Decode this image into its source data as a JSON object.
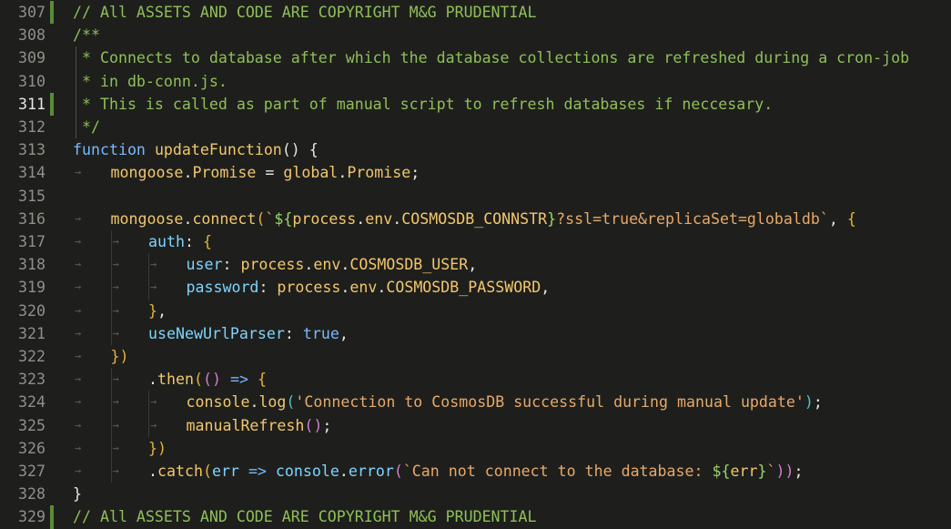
{
  "colors": {
    "background": "#1e1f1c",
    "comment": "#8fbf58",
    "keyword": "#79b8ff",
    "function": "#f2c66d",
    "plain": "#e7e7e2",
    "string": "#e6a86b",
    "property": "#7fd3ff",
    "constant": "#ae8cfc",
    "bracket_gold": "#e2b23c",
    "bracket_pink": "#d67ad7",
    "bracket_teal": "#4fc1c7",
    "interp": "#9ad66a",
    "gutter_modified": "#5a8b39",
    "line_number": "#8f908a",
    "line_number_active": "#e8e8e2",
    "whitespace": "#5a5b55"
  },
  "active_line": "311",
  "lines": [
    {
      "num": "307",
      "mod": true,
      "indent": 0,
      "tokens": [
        {
          "t": "// All ASSETS AND CODE ARE COPYRIGHT M&G PRUDENTIAL",
          "c": "comment"
        }
      ]
    },
    {
      "num": "308",
      "mod": false,
      "indent": 0,
      "tokens": [
        {
          "t": "/**",
          "c": "comment"
        }
      ]
    },
    {
      "num": "309",
      "mod": false,
      "indent": 0,
      "bar": true,
      "tokens": [
        {
          "t": " * Connects to database after which the database collections are refreshed during a cron-job",
          "c": "comment"
        }
      ]
    },
    {
      "num": "310",
      "mod": false,
      "indent": 0,
      "bar": true,
      "tokens": [
        {
          "t": " * in db-conn.js.",
          "c": "comment"
        }
      ]
    },
    {
      "num": "311",
      "mod": true,
      "indent": 0,
      "bar": true,
      "tokens": [
        {
          "t": " * This is called as part of manual script to refresh databases if neccesary.",
          "c": "comment"
        }
      ]
    },
    {
      "num": "312",
      "mod": false,
      "indent": 0,
      "bar": true,
      "tokens": [
        {
          "t": " */",
          "c": "comment"
        }
      ]
    },
    {
      "num": "313",
      "mod": false,
      "indent": 0,
      "tokens": [
        {
          "t": "function",
          "c": "keyword"
        },
        {
          "t": " ",
          "c": "plain"
        },
        {
          "t": "updateFunction",
          "c": "function"
        },
        {
          "t": "() {",
          "c": "plain"
        }
      ]
    },
    {
      "num": "314",
      "mod": false,
      "indent": 1,
      "tokens": [
        {
          "t": "mongoose",
          "c": "function"
        },
        {
          "t": ".",
          "c": "plain"
        },
        {
          "t": "Promise",
          "c": "function"
        },
        {
          "t": " = ",
          "c": "plain"
        },
        {
          "t": "global",
          "c": "function"
        },
        {
          "t": ".",
          "c": "plain"
        },
        {
          "t": "Promise",
          "c": "function"
        },
        {
          "t": ";",
          "c": "plain"
        }
      ]
    },
    {
      "num": "315",
      "mod": false,
      "indent": 0,
      "tokens": []
    },
    {
      "num": "316",
      "mod": false,
      "indent": 1,
      "tokens": [
        {
          "t": "mongoose",
          "c": "function"
        },
        {
          "t": ".",
          "c": "plain"
        },
        {
          "t": "connect",
          "c": "function"
        },
        {
          "t": "(",
          "c": "bracket_gold"
        },
        {
          "t": "`",
          "c": "string"
        },
        {
          "t": "${",
          "c": "interp"
        },
        {
          "t": "process",
          "c": "function"
        },
        {
          "t": ".",
          "c": "plain"
        },
        {
          "t": "env",
          "c": "function"
        },
        {
          "t": ".",
          "c": "plain"
        },
        {
          "t": "COSMOSDB_CONNSTR",
          "c": "function"
        },
        {
          "t": "}",
          "c": "interp"
        },
        {
          "t": "?ssl=true&replicaSet=globaldb`",
          "c": "string"
        },
        {
          "t": ", ",
          "c": "plain"
        },
        {
          "t": "{",
          "c": "bracket_gold"
        }
      ]
    },
    {
      "num": "317",
      "mod": false,
      "indent": 2,
      "tokens": [
        {
          "t": "auth",
          "c": "property"
        },
        {
          "t": ": ",
          "c": "plain"
        },
        {
          "t": "{",
          "c": "bracket_gold"
        }
      ]
    },
    {
      "num": "318",
      "mod": false,
      "indent": 3,
      "tokens": [
        {
          "t": "user",
          "c": "property"
        },
        {
          "t": ": ",
          "c": "plain"
        },
        {
          "t": "process",
          "c": "function"
        },
        {
          "t": ".",
          "c": "plain"
        },
        {
          "t": "env",
          "c": "function"
        },
        {
          "t": ".",
          "c": "plain"
        },
        {
          "t": "COSMOSDB_USER",
          "c": "function"
        },
        {
          "t": ",",
          "c": "plain"
        }
      ]
    },
    {
      "num": "319",
      "mod": false,
      "indent": 3,
      "tokens": [
        {
          "t": "password",
          "c": "property"
        },
        {
          "t": ": ",
          "c": "plain"
        },
        {
          "t": "process",
          "c": "function"
        },
        {
          "t": ".",
          "c": "plain"
        },
        {
          "t": "env",
          "c": "function"
        },
        {
          "t": ".",
          "c": "plain"
        },
        {
          "t": "COSMOSDB_PASSWORD",
          "c": "function"
        },
        {
          "t": ",",
          "c": "plain"
        }
      ]
    },
    {
      "num": "320",
      "mod": false,
      "indent": 2,
      "tokens": [
        {
          "t": "}",
          "c": "bracket_gold"
        },
        {
          "t": ",",
          "c": "plain"
        }
      ]
    },
    {
      "num": "321",
      "mod": false,
      "indent": 2,
      "tokens": [
        {
          "t": "useNewUrlParser",
          "c": "property"
        },
        {
          "t": ": ",
          "c": "plain"
        },
        {
          "t": "true",
          "c": "keyword"
        },
        {
          "t": ",",
          "c": "plain"
        }
      ]
    },
    {
      "num": "322",
      "mod": false,
      "indent": 1,
      "tokens": [
        {
          "t": "})",
          "c": "bracket_gold"
        }
      ]
    },
    {
      "num": "323",
      "mod": false,
      "indent": 2,
      "tokens": [
        {
          "t": ".",
          "c": "plain"
        },
        {
          "t": "then",
          "c": "function"
        },
        {
          "t": "(",
          "c": "bracket_gold"
        },
        {
          "t": "()",
          "c": "bracket_pink"
        },
        {
          "t": " ",
          "c": "plain"
        },
        {
          "t": "=>",
          "c": "keyword"
        },
        {
          "t": " ",
          "c": "plain"
        },
        {
          "t": "{",
          "c": "bracket_gold"
        }
      ]
    },
    {
      "num": "324",
      "mod": false,
      "indent": 3,
      "tokens": [
        {
          "t": "console",
          "c": "function"
        },
        {
          "t": ".",
          "c": "plain"
        },
        {
          "t": "log",
          "c": "function"
        },
        {
          "t": "(",
          "c": "bracket_teal"
        },
        {
          "t": "'Connection to CosmosDB successful during manual update'",
          "c": "string"
        },
        {
          "t": ")",
          "c": "bracket_teal"
        },
        {
          "t": ";",
          "c": "plain"
        }
      ]
    },
    {
      "num": "325",
      "mod": false,
      "indent": 3,
      "tokens": [
        {
          "t": "manualRefresh",
          "c": "function"
        },
        {
          "t": "()",
          "c": "bracket_pink"
        },
        {
          "t": ";",
          "c": "plain"
        }
      ]
    },
    {
      "num": "326",
      "mod": false,
      "indent": 2,
      "tokens": [
        {
          "t": "})",
          "c": "bracket_gold"
        }
      ]
    },
    {
      "num": "327",
      "mod": false,
      "indent": 2,
      "tokens": [
        {
          "t": ".",
          "c": "plain"
        },
        {
          "t": "catch",
          "c": "function"
        },
        {
          "t": "(",
          "c": "bracket_gold"
        },
        {
          "t": "err",
          "c": "property"
        },
        {
          "t": " ",
          "c": "plain"
        },
        {
          "t": "=>",
          "c": "keyword"
        },
        {
          "t": " ",
          "c": "plain"
        },
        {
          "t": "console",
          "c": "property"
        },
        {
          "t": ".",
          "c": "plain"
        },
        {
          "t": "error",
          "c": "property"
        },
        {
          "t": "(",
          "c": "bracket_pink"
        },
        {
          "t": "`Can not connect to the database: ",
          "c": "string"
        },
        {
          "t": "${",
          "c": "interp"
        },
        {
          "t": "err",
          "c": "function"
        },
        {
          "t": "}",
          "c": "interp"
        },
        {
          "t": "`",
          "c": "string"
        },
        {
          "t": "))",
          "c": "bracket_pink"
        },
        {
          "t": ";",
          "c": "plain"
        }
      ]
    },
    {
      "num": "328",
      "mod": false,
      "indent": 0,
      "tokens": [
        {
          "t": "}",
          "c": "plain"
        }
      ]
    },
    {
      "num": "329",
      "mod": true,
      "indent": 0,
      "tokens": [
        {
          "t": "// All ASSETS AND CODE ARE COPYRIGHT M&G PRUDENTIAL",
          "c": "comment"
        }
      ]
    }
  ]
}
